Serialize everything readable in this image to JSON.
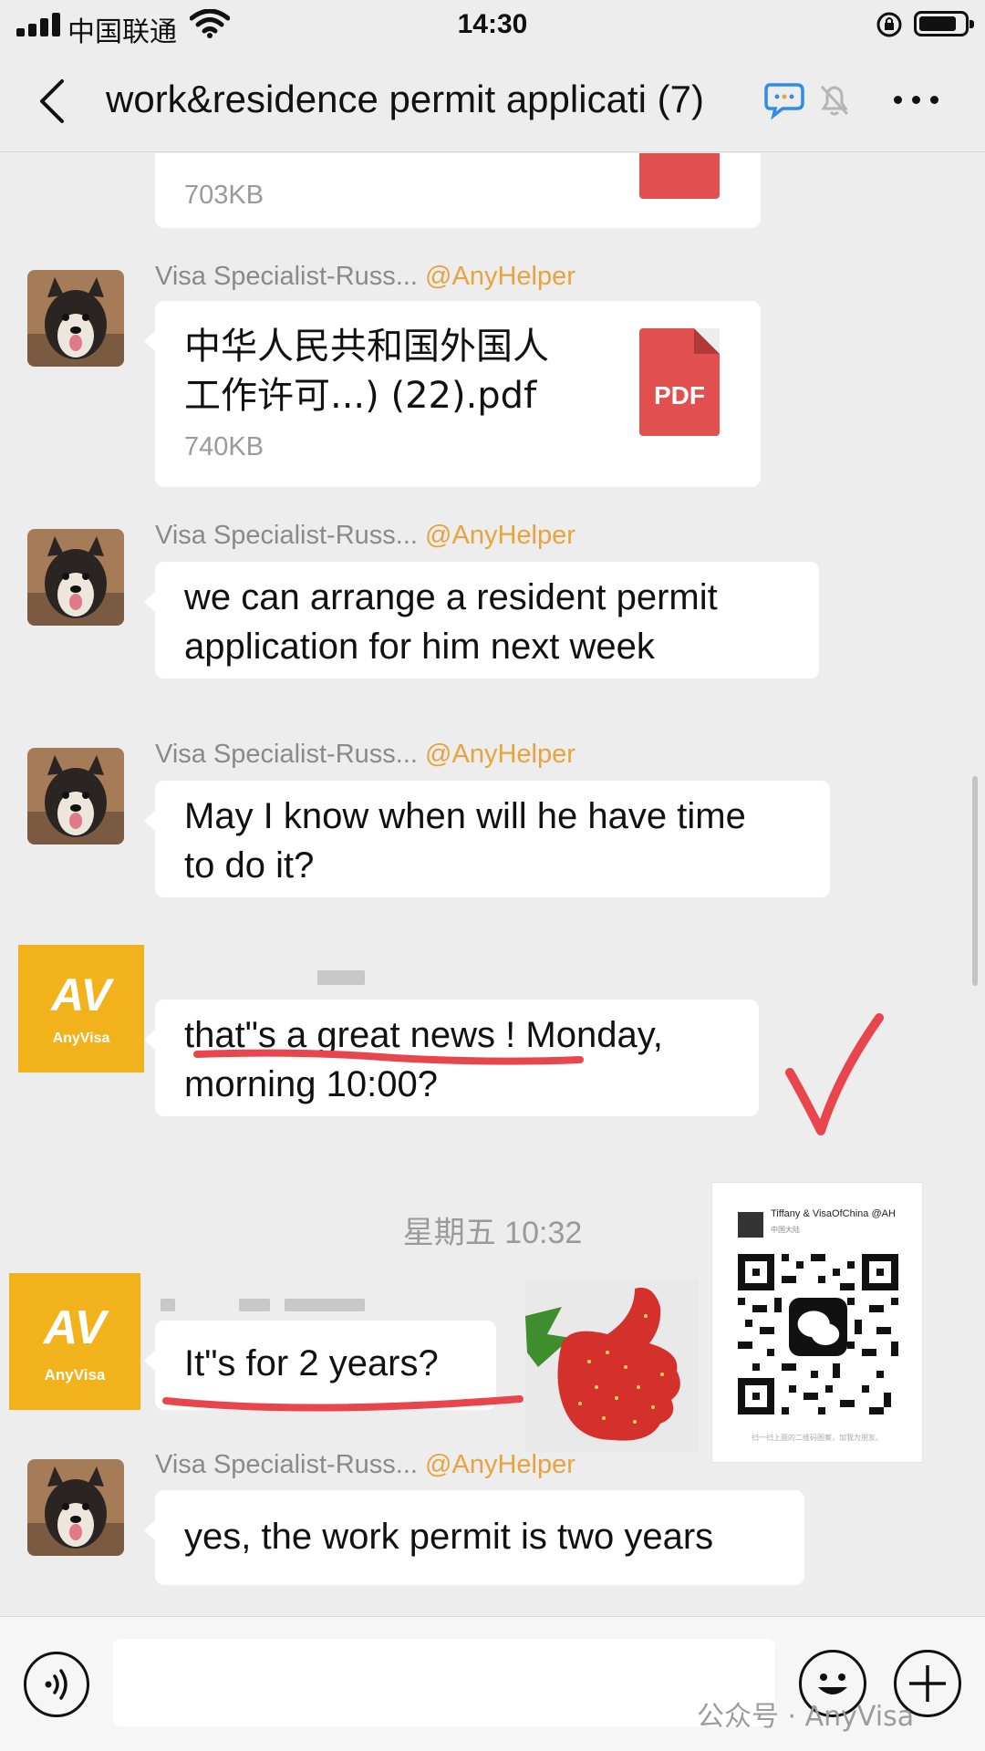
{
  "status_bar": {
    "carrier": "中国联通",
    "time": "14:30"
  },
  "header": {
    "title": "work&residence permit applicati",
    "member_count": "(7)"
  },
  "messages": {
    "file_top": {
      "size": "703KB"
    },
    "file_msg": {
      "sender": "Visa Specialist-Russ...",
      "mention": "@AnyHelper",
      "file_name_line1": "中华人民共和国外国人",
      "file_name_line2": "工作许可...) (22).pdf",
      "size": "740KB",
      "file_type": "PDF"
    },
    "msg1": {
      "sender": "Visa Specialist-Russ...",
      "mention": "@AnyHelper",
      "line1": "we can arrange a resident permit",
      "line2": "application for him next week"
    },
    "msg2": {
      "sender": "Visa Specialist-Russ...",
      "mention": "@AnyHelper",
      "line1": "May I know when will he have time",
      "line2": "to do it?"
    },
    "msg3": {
      "avatar_logo": "AV",
      "avatar_name": "AnyVisa",
      "line1": "that\"s a great news ! Monday,",
      "line2": "morning 10:00?"
    },
    "time_separator": "星期五 10:32",
    "msg4": {
      "avatar_logo": "AV",
      "avatar_name": "AnyVisa",
      "text": "It\"s for 2 years?"
    },
    "msg5": {
      "sender": "Visa Specialist-Russ...",
      "mention": "@AnyHelper",
      "text": "yes, the work permit is two years"
    }
  },
  "qr_card": {
    "name": "Tiffany & VisaOfChina @AH",
    "region": "中国大陆",
    "footer": "扫一扫上面的二维码图案，加我为朋友。"
  },
  "input_bar": {
    "watermark": "公众号 · AnyVisa"
  },
  "colors": {
    "mention": "#e8a33d",
    "anyvisa_brand": "#f2b21b",
    "underline": "#e8464c",
    "pdf": "#e24f4f"
  }
}
